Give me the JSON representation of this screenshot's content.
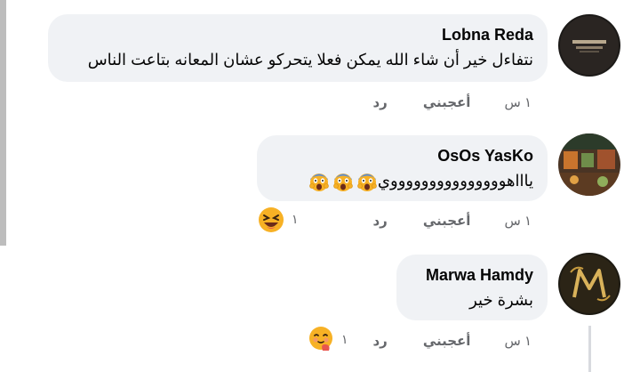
{
  "comments": [
    {
      "author": "Lobna Reda",
      "text": "نتفاءل خير أن شاء الله يمكن فعلا يتحركو عشان المعانه بتاعت الناس",
      "time": "١ س",
      "like_label": "أعجبني",
      "reply_label": "رد",
      "avatar_icon": "dark-avatar-with-arabic-text"
    },
    {
      "author": "OsOs YasKo",
      "text": "ياااهوووووووووووووووي",
      "emojis": [
        "screaming-face-emoji",
        "screaming-face-emoji",
        "screaming-face-emoji"
      ],
      "time": "١ س",
      "like_label": "أعجبني",
      "reply_label": "رد",
      "reaction_count": "١",
      "reaction_icon": "laughing-face-emoji",
      "avatar_icon": "cafe-interior-avatar"
    },
    {
      "author": "Marwa Hamdy",
      "text": "بشرة خير",
      "time": "١ س",
      "like_label": "أعجبني",
      "reply_label": "رد",
      "reaction_count": "١",
      "reaction_icon": "hugging-face-emoji",
      "avatar_icon": "gold-m-monogram-avatar"
    }
  ],
  "colors": {
    "bubble": "#f0f2f5",
    "meta_text": "#65676b",
    "name_text": "#050505",
    "emoji_yellow": "#f7b125"
  }
}
